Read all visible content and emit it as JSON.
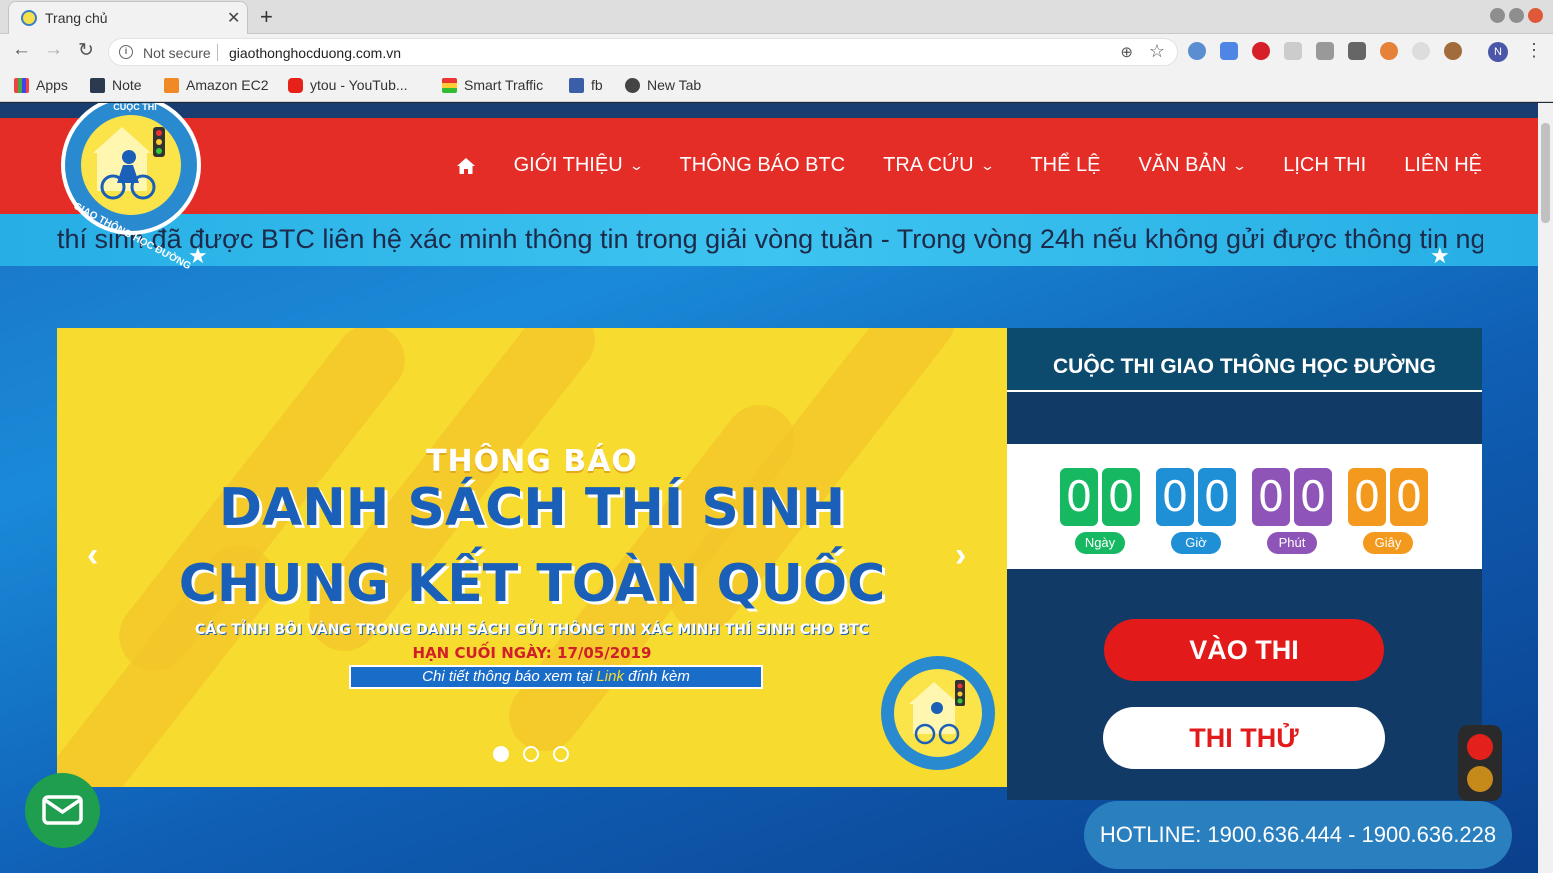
{
  "browser": {
    "tab_title": "Trang chủ",
    "not_secure": "Not secure",
    "url": "giaothonghocduong.com.vn",
    "profile_initial": "N",
    "bookmarks": [
      "Apps",
      "Note",
      "Amazon EC2",
      "ytou - YouTub...",
      "Smart Traffic",
      "fb",
      "New Tab"
    ]
  },
  "header": {
    "nav": [
      "GIỚI THIỆU",
      "THÔNG BÁO BTC",
      "TRA CỨU",
      "THỂ LỆ",
      "VĂN BẢN",
      "LỊCH THI",
      "LIÊN HỆ"
    ],
    "logo_text_top": "CUỘC THI",
    "logo_text_bottom": "GIAO THÔNG HỌC ĐƯỜNG"
  },
  "ticker": {
    "text": "thí sinh đã được BTC liên hệ xác minh thông tin trong giải vòng tuần - Trong vòng 24h nếu không gửi được thông tin ng"
  },
  "slide": {
    "small_title": "THÔNG BÁO",
    "line1": "DANH SÁCH THÍ SINH",
    "line2": "CHUNG KẾT TOÀN QUỐC",
    "subtitle": "CÁC TỈNH BÔI VÀNG TRONG DANH SÁCH GỬI THÔNG TIN XÁC MINH THÍ SINH CHO BTC",
    "deadline": "HẠN CUỐI NGÀY: 17/05/2019",
    "link_prefix": "Chi tiết thông báo xem tại ",
    "link_word": "Link",
    "link_suffix": " đính kèm",
    "dots_count": 3,
    "active_dot": 1
  },
  "panel": {
    "title": "CUỘC THI GIAO THÔNG HỌC ĐƯỜNG",
    "countdown": {
      "days": [
        "0",
        "0"
      ],
      "days_label": "Ngày",
      "hours": [
        "0",
        "0"
      ],
      "hours_label": "Giờ",
      "minutes": [
        "0",
        "0"
      ],
      "minutes_label": "Phút",
      "seconds": [
        "0",
        "0"
      ],
      "seconds_label": "Giây"
    },
    "btn_enter": "VÀO THI",
    "btn_trial": "THI THỬ"
  },
  "hotline": "HOTLINE: 1900.636.444 - 1900.636.228",
  "colors": {
    "header_red": "#e52d27",
    "days": "#17b862",
    "hours": "#1f8fd6",
    "minutes": "#8e54b7",
    "seconds": "#f39a1e",
    "enter_btn": "#e31a1a"
  }
}
